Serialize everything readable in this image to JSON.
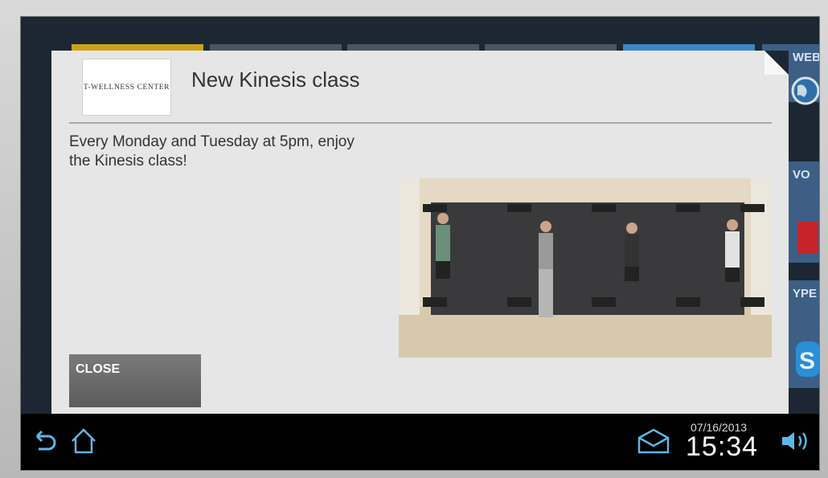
{
  "background": {
    "side_tiles": [
      "WEB",
      "VO",
      "YPE"
    ]
  },
  "dialog": {
    "logo_text": "T-WELLNESS CENTER",
    "title": "New Kinesis class",
    "body": "Every Monday and Tuesday at 5pm, enjoy the Kinesis class!",
    "photo_icon": "kinesis-class-photo",
    "close_label": "CLOSE"
  },
  "navbar": {
    "back_icon": "back-icon",
    "home_icon": "home-icon",
    "mail_icon": "mail-icon",
    "volume_icon": "volume-icon",
    "date": "07/16/2013",
    "time": "15:34"
  },
  "colors": {
    "dialog_bg": "#e6e6e6",
    "close_button": "#666666",
    "navbar_bg": "#000000",
    "screen_bg": "#1d2733"
  }
}
